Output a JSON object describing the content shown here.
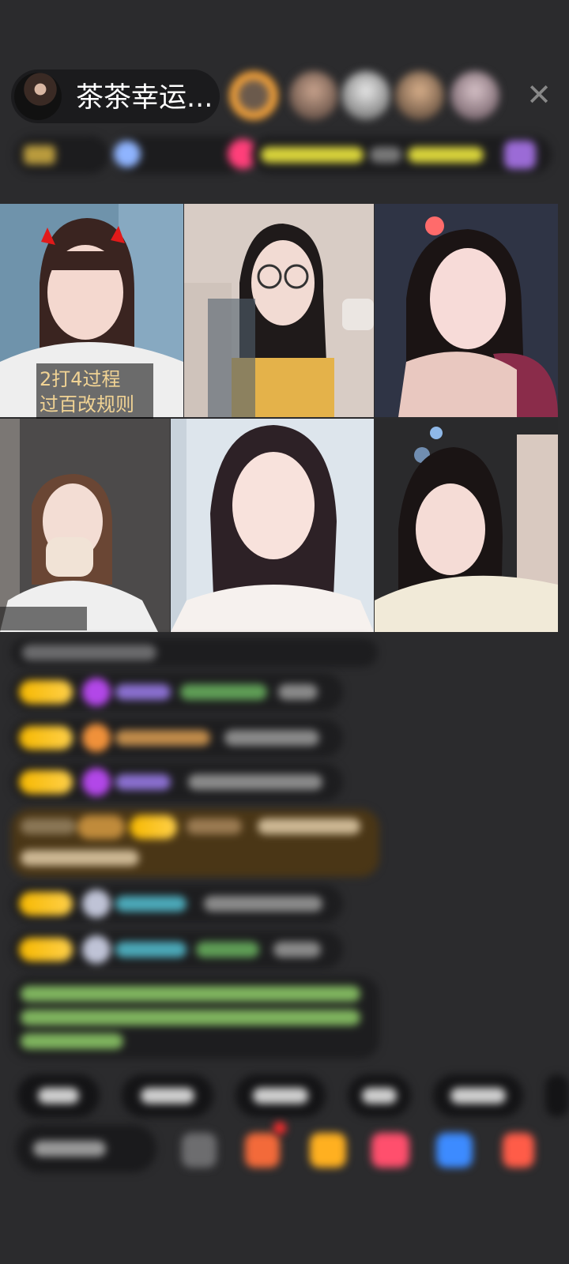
{
  "host": {
    "name": "茶茶幸运...",
    "avatar_icon": "host-avatar"
  },
  "header": {
    "close_icon": "close-icon",
    "close_glyph": "✕"
  },
  "tile_caption": {
    "line1": "2打4过程",
    "line2": "过百改规则"
  },
  "colors": {
    "background": "#2b2b2d",
    "badge_gold": "#f6b800",
    "chat_green": "#8fd16f",
    "chat_cyan": "#5dc5d8",
    "caption_text": "#f1d394"
  }
}
